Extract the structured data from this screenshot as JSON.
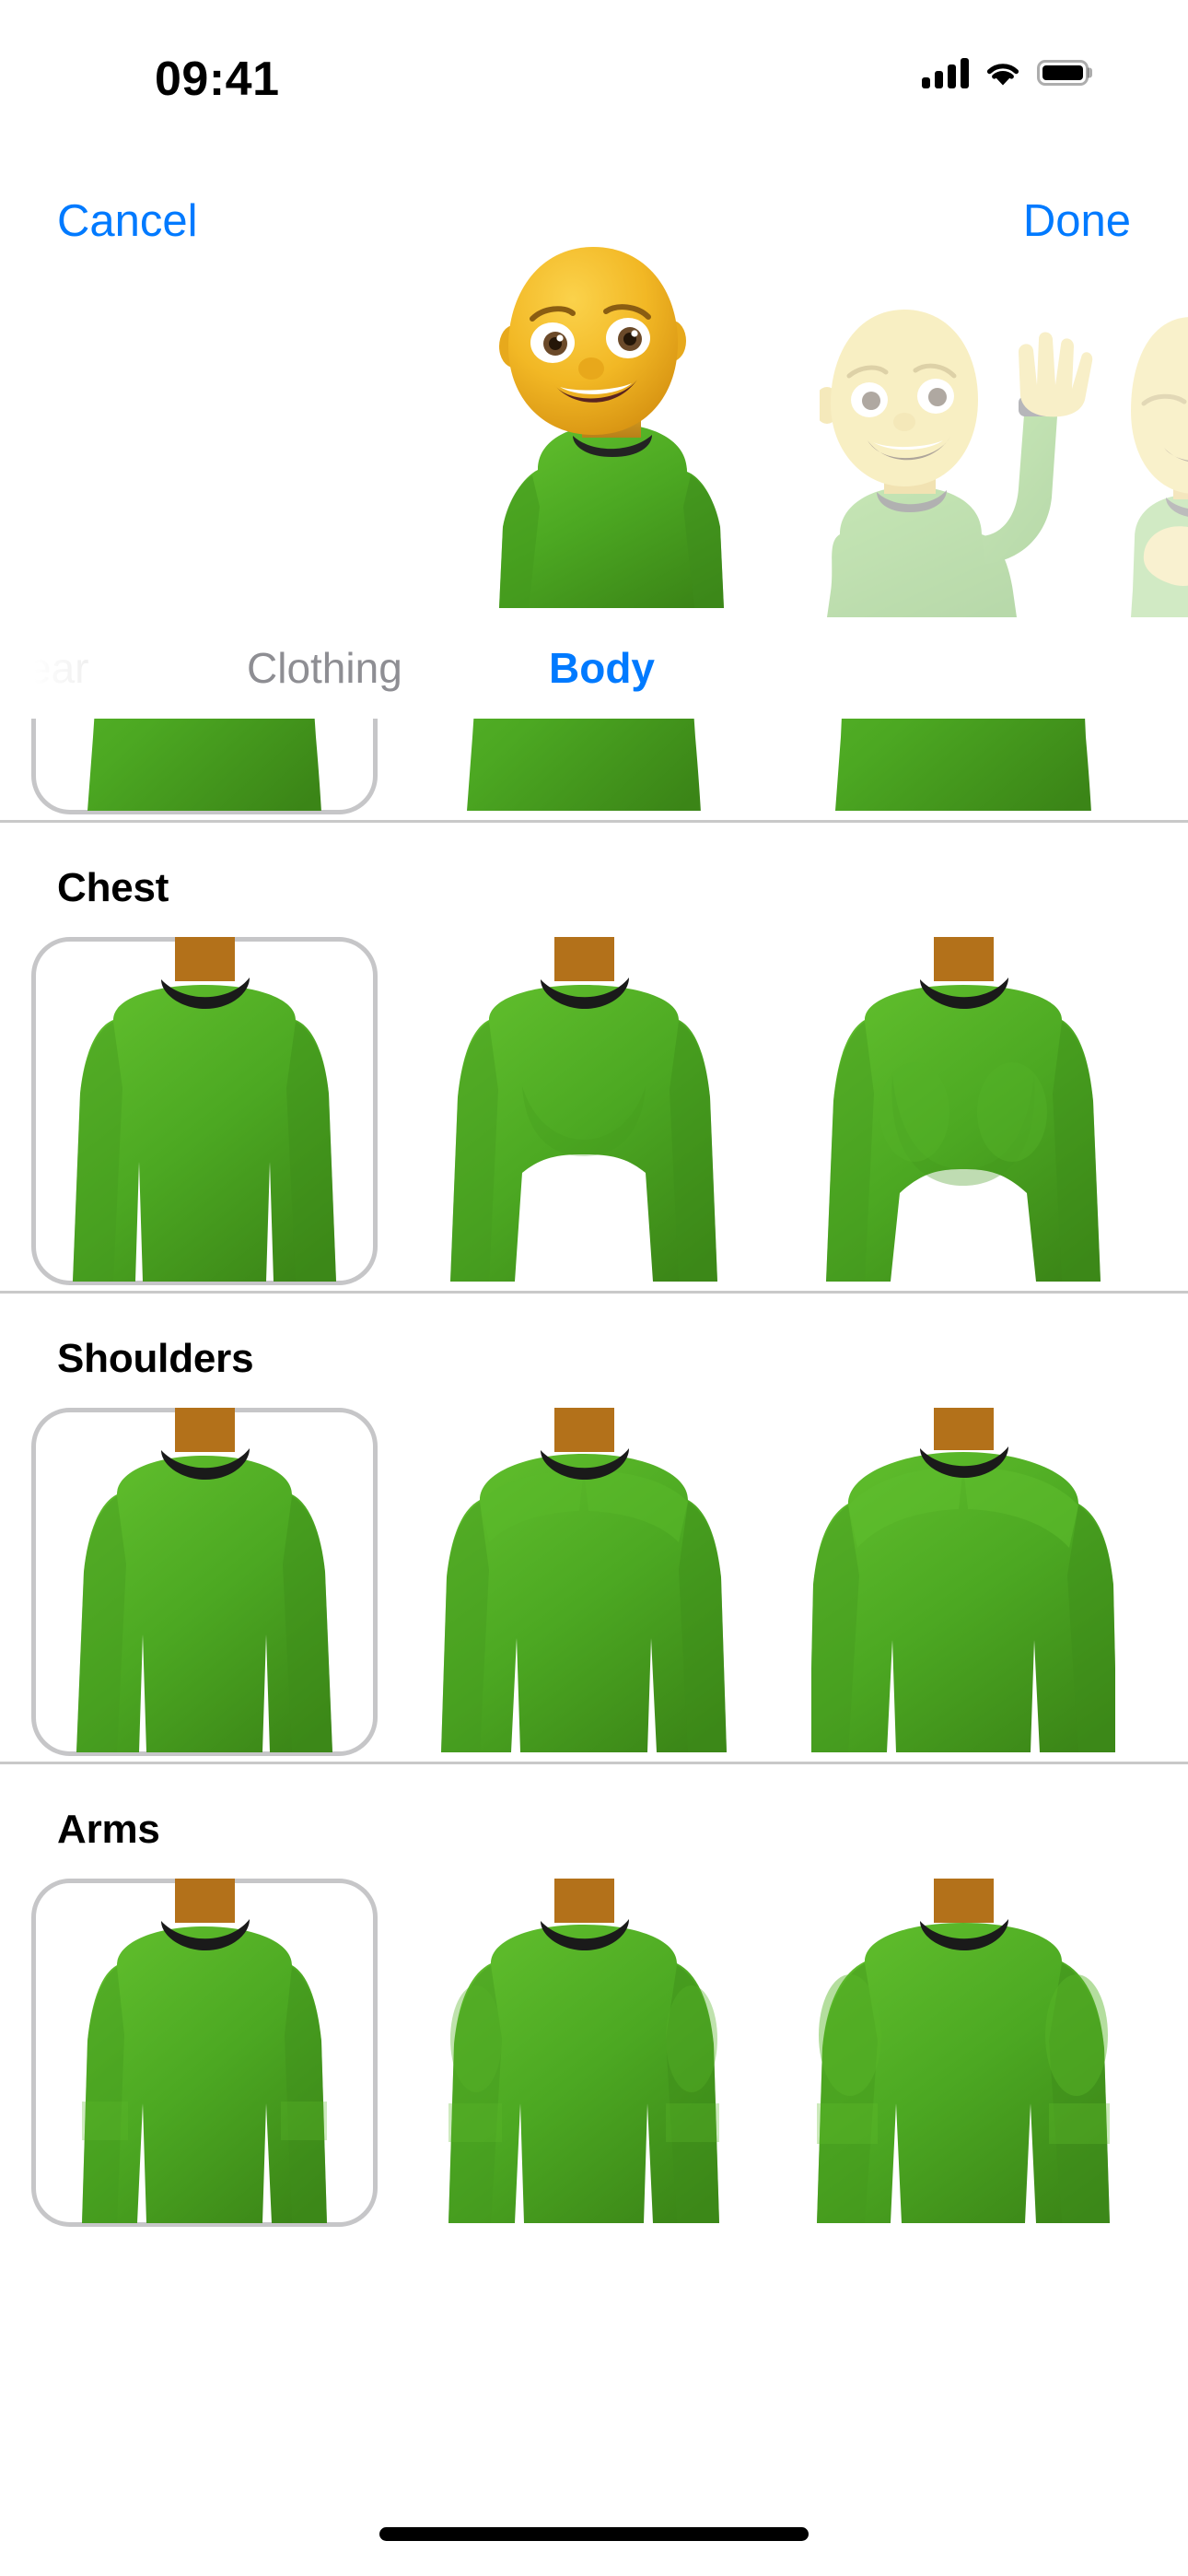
{
  "status_bar": {
    "time": "09:41",
    "cellular_icon": "cellular-signal-icon",
    "cellular_bars": 4,
    "wifi_icon": "wifi-icon",
    "battery_icon": "battery-icon",
    "battery_full": true
  },
  "nav_bar": {
    "cancel_label": "Cancel",
    "done_label": "Done",
    "accent_color": "#007AFF"
  },
  "preview": {
    "main_avatar_name": "memoji-avatar-preview",
    "sticker_wave_name": "memoji-sticker-wave",
    "sticker_edge_name": "memoji-sticker-partial",
    "skin_color": "#F0B42A",
    "shirt_color": "#4CA822",
    "collar_color": "#2B2B2B"
  },
  "tabs": [
    {
      "label": "ear",
      "selected": false,
      "clipped": true
    },
    {
      "label": "Clothing",
      "selected": false,
      "clipped": false
    },
    {
      "label": "Body",
      "selected": true,
      "clipped": false
    }
  ],
  "sections": [
    {
      "title": "",
      "clipped": true,
      "options": [
        {
          "selected": true,
          "variant": "a"
        },
        {
          "selected": false,
          "variant": "b"
        },
        {
          "selected": false,
          "variant": "c"
        }
      ]
    },
    {
      "title": "Chest",
      "clipped": false,
      "options": [
        {
          "selected": true,
          "variant": "chest-flat"
        },
        {
          "selected": false,
          "variant": "chest-medium"
        },
        {
          "selected": false,
          "variant": "chest-large"
        }
      ]
    },
    {
      "title": "Shoulders",
      "clipped": false,
      "options": [
        {
          "selected": true,
          "variant": "shoulders-narrow"
        },
        {
          "selected": false,
          "variant": "shoulders-medium"
        },
        {
          "selected": false,
          "variant": "shoulders-broad"
        }
      ]
    },
    {
      "title": "Arms",
      "clipped": false,
      "options": [
        {
          "selected": true,
          "variant": "arms-slim"
        },
        {
          "selected": false,
          "variant": "arms-medium"
        },
        {
          "selected": false,
          "variant": "arms-muscular"
        }
      ]
    }
  ],
  "colors": {
    "shirt_green": "#4CA822",
    "shirt_green_dark": "#3E8C1B",
    "shirt_green_light": "#66BC33",
    "neck_brown": "#B3711A",
    "collar_black": "#1E1E1E",
    "separator": "#C9C9C9",
    "selection_ring": "#C6C6C8",
    "tab_inactive": "#8E8E93",
    "ios_blue": "#007AFF"
  },
  "home_indicator": {
    "name": "home-indicator"
  }
}
